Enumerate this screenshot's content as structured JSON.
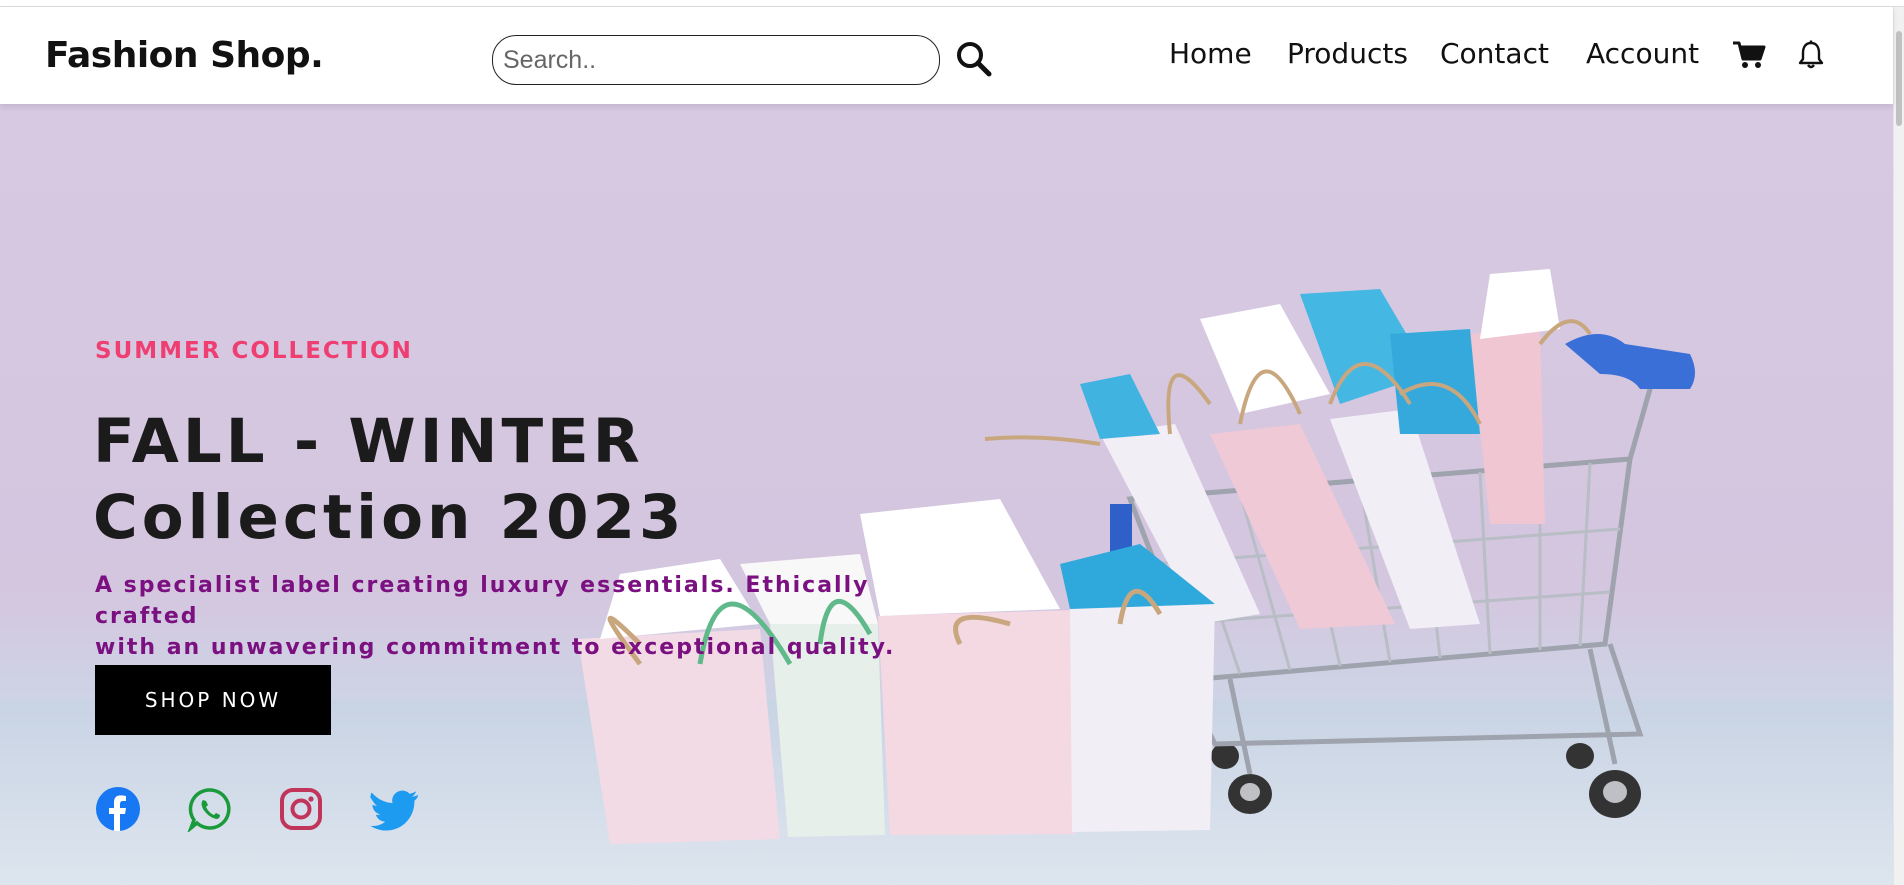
{
  "navbar": {
    "logo": "Fashion Shop.",
    "search_placeholder": "Search..",
    "links": [
      "Home",
      "Products",
      "Contact",
      "Account"
    ],
    "icons": [
      "search-icon",
      "cart-icon",
      "bell-icon"
    ]
  },
  "hero": {
    "eyebrow": "SUMMER COLLECTION",
    "headline_line1": "FALL - WINTER",
    "headline_line2": "Collection 2023",
    "subtext_line1": "A specialist label creating luxury essentials. Ethically crafted",
    "subtext_line2": "with an unwavering commitment to exceptional quality.",
    "cta_label": "SHOP NOW",
    "social": [
      "facebook-icon",
      "whatsapp-icon",
      "instagram-icon",
      "twitter-icon"
    ]
  },
  "colors": {
    "accent_pink": "#ee3e72",
    "subtext_purple": "#7b1080",
    "facebook": "#1877f2",
    "whatsapp": "#1a9a3a",
    "instagram": "#c1355b",
    "twitter": "#1d9bf0"
  }
}
